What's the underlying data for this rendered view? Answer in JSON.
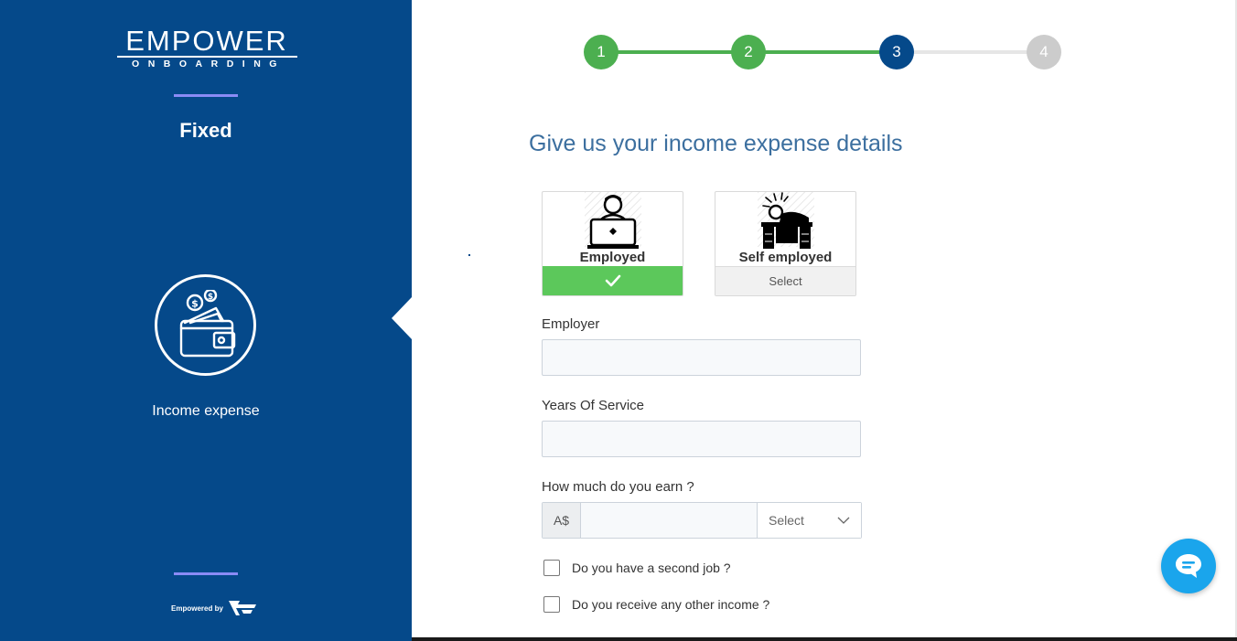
{
  "brand": {
    "logo_main": "EMPOWER",
    "logo_sub": "ONBOARDING",
    "powered_by": "Empowered by"
  },
  "sidebar": {
    "plan_title": "Fixed",
    "step_label": "Income expense",
    "step_icon": "wallet-icon"
  },
  "stepper": {
    "steps": [
      {
        "label": "1",
        "state": "completed"
      },
      {
        "label": "2",
        "state": "completed"
      },
      {
        "label": "3",
        "state": "active"
      },
      {
        "label": "4",
        "state": "pending"
      }
    ]
  },
  "form": {
    "heading": "Give us your income expense details",
    "employment_options": [
      {
        "label": "Employed",
        "footer": "",
        "selected": true,
        "icon": "employee-laptop-icon"
      },
      {
        "label": "Self employed",
        "footer": "Select",
        "selected": false,
        "icon": "self-employed-desk-icon"
      }
    ],
    "employer_label": "Employer",
    "employer_value": "",
    "years_label": "Years Of Service",
    "years_value": "",
    "earn_label": "How much do you earn ?",
    "currency_prefix": "A$",
    "earn_value": "",
    "frequency_select": "Select",
    "second_job_label": "Do you have a second job ?",
    "second_job_checked": false,
    "other_income_label": "Do you receive any other income ?",
    "other_income_checked": false
  },
  "chat": {
    "icon": "chat-bubble-icon"
  },
  "colors": {
    "sidebar_bg": "#05498a",
    "completed": "#4caf50",
    "active": "#05498a",
    "pending": "#cccccc",
    "selected_card": "#5cc85b",
    "accent": "#8b8bf5",
    "chat": "#1aa5ec"
  }
}
